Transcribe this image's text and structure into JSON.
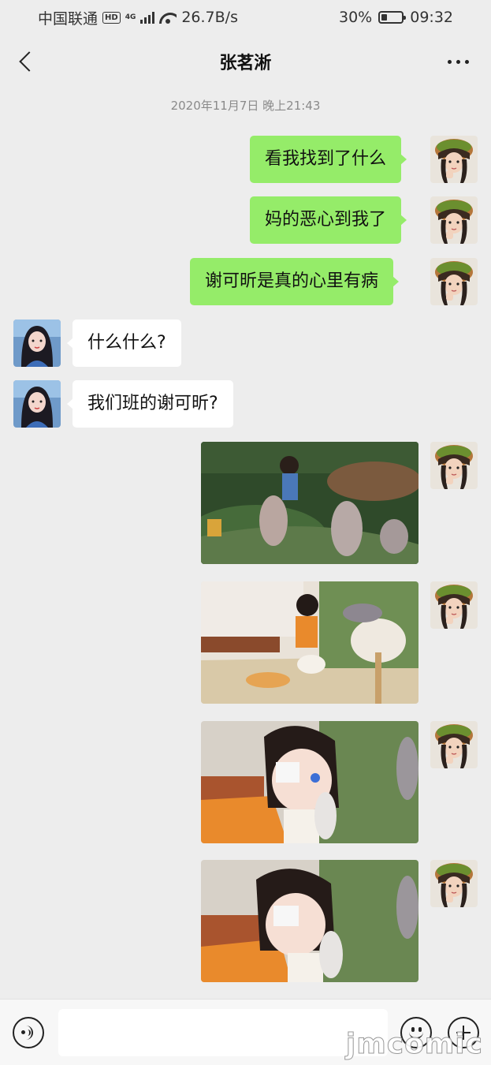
{
  "status_bar": {
    "carrier": "中国联通",
    "hd": "HD",
    "network": "4G",
    "speed": "26.7B/s",
    "battery": "30%",
    "battery_level": 0.3,
    "time": "09:32"
  },
  "nav": {
    "title": "张茗淅"
  },
  "timestamp": "2020年11月7日 晚上21:43",
  "messages": [
    {
      "side": "out",
      "text": "看我找到了什么"
    },
    {
      "side": "out",
      "text": "妈的恶心到我了"
    },
    {
      "side": "out",
      "text": "谢可昕是真的心里有病"
    },
    {
      "side": "in",
      "text": "什么什么?"
    },
    {
      "side": "in",
      "text": "我们班的谢可昕?"
    },
    {
      "side": "out",
      "type": "image"
    },
    {
      "side": "out",
      "type": "image"
    },
    {
      "side": "out",
      "type": "image"
    },
    {
      "side": "out",
      "type": "image"
    }
  ],
  "colors": {
    "background": "#ededed",
    "outgoing_bubble": "#95ec69",
    "incoming_bubble": "#ffffff"
  },
  "icons": [
    "back-arrow-icon",
    "more-icon",
    "voice-icon",
    "emoji-icon",
    "plus-icon"
  ],
  "watermark": "jmcomic"
}
